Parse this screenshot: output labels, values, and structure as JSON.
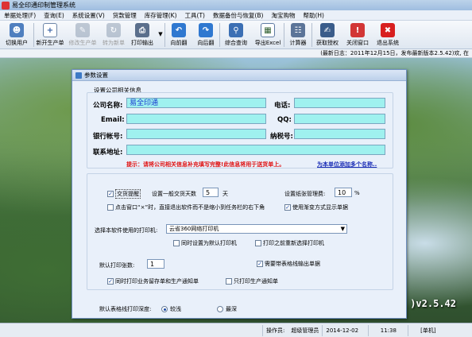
{
  "window": {
    "title": "易全印通印制管理系统"
  },
  "menu": [
    "单据处理(F)",
    "查询(E)",
    "系统设置(V)",
    "货款管理",
    "库存管理(K)",
    "工具(T)",
    "数据备份与恢复(B)",
    "淘宝购物",
    "帮助(H)"
  ],
  "toolbar": {
    "switch_user": "切换用户",
    "new_order": "新开生产单",
    "edit_order": "修改生产单",
    "convert_order": "转为新单",
    "print_output": "打印输出",
    "page_prev": "向前翻",
    "page_next": "向后翻",
    "query": "综合查询",
    "export_excel": "导出Excel",
    "calculator": "计算器",
    "get_license": "获取授权",
    "close_window": "关闭窗口",
    "exit_system": "退出系统"
  },
  "update_notice": "(最新日志：2011年12月15日，发布最新版本2.5.42)欢, 在",
  "dialog": {
    "title": "参数设置",
    "company_section": "设置公司相关信息",
    "company_name_label": "公司名称:",
    "company_name_value": "易全印通",
    "phone_label": "电话:",
    "email_label": "Email:",
    "qq_label": "QQ:",
    "bank_label": "银行帐号:",
    "tax_label": "纳税号:",
    "address_label": "联系地址:",
    "warning": "提示：请将公司相关信息补充填写完整!此信息将用于送货单上。",
    "link": "为本单位添加多个名称..",
    "cb_alert": "交货提醒",
    "delivery_days_label": "设置一般交货天数",
    "delivery_days_value": "5",
    "days_unit": "天",
    "paper_loss_label": "设置纸张管理费:",
    "paper_loss_value": "10",
    "percent": "%",
    "cb_close_tray": "点击窗口“×”时，直接退出软件而不是缩小到任务栏的右下角",
    "cb_gradient": "使用渐变方式显示单据",
    "printer_label": "选择本软件使用的打印机:",
    "printer_value": "云省360网络打印机",
    "cb_default_printer": "同时设置为默认打印机",
    "cb_reselect_printer": "打印之前重新选择打印机",
    "copies_label": "默认打印张数:",
    "copies_value": "1",
    "cb_table_lines": "需要带表格线输出单据",
    "cb_print_notice": "同时打印业务留存单和生产通知单",
    "cb_print_only_notice": "只打印生产通知单",
    "depth_label": "默认表格线打印深度:",
    "radio_light": "较浅",
    "radio_dark": "最深"
  },
  "version": ")v2.5.42",
  "status": {
    "operator_label": "操作员:",
    "operator_value": "超级管理员",
    "date": "2014-12-02",
    "time": "11:38",
    "mode": "[单机]"
  },
  "colors": {
    "field_bg": "#9ff1ef",
    "warning": "#e01010",
    "link": "#1a2db6"
  }
}
